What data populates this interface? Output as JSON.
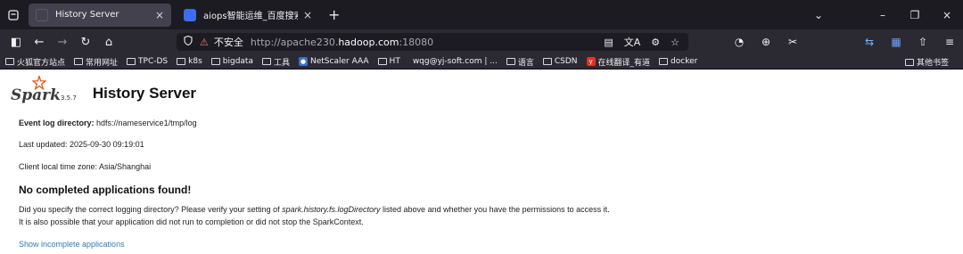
{
  "browser": {
    "tabs": [
      {
        "title": "History Server",
        "close": "×",
        "active": true
      },
      {
        "title": "aiops智能运维_百度搜索",
        "close": "×",
        "active": false
      }
    ],
    "new_tab": "+",
    "window_controls": {
      "list": "⌄",
      "minimize": "–",
      "restore": "❐",
      "close": "×"
    },
    "nav": {
      "sidebar": "◧",
      "back": "←",
      "forward": "→",
      "reload": "↻",
      "home": "⌂"
    },
    "url": {
      "insecure_icon": "⚠",
      "insecure_label": "不安全",
      "prefix": "http://apache230.",
      "host": "hadoop.com",
      "suffix": ":18080"
    },
    "url_actions": {
      "reader": "▤",
      "translate": "文A",
      "extensions": "⚙",
      "bookmark": "☆"
    },
    "toolbar_right": [
      "◔",
      "⊕",
      "✂",
      "⇆",
      "▦",
      "⇧",
      "≡"
    ],
    "bookmarks": [
      {
        "label": "火狐官方站点",
        "type": "folder"
      },
      {
        "label": "常用网址",
        "type": "folder"
      },
      {
        "label": "TPC-DS",
        "type": "folder"
      },
      {
        "label": "k8s",
        "type": "folder"
      },
      {
        "label": "bigdata",
        "type": "folder"
      },
      {
        "label": "工具",
        "type": "folder"
      },
      {
        "label": "NetScaler AAA",
        "type": "site"
      },
      {
        "label": "HT",
        "type": "folder"
      },
      {
        "label": "wqg@yj-soft.com | ...",
        "type": "plain"
      },
      {
        "label": "语言",
        "type": "folder"
      },
      {
        "label": "CSDN",
        "type": "folder"
      },
      {
        "label": "在线翻译_有道",
        "type": "youdao"
      },
      {
        "label": "docker",
        "type": "folder"
      }
    ],
    "other_bookmarks": "其他书签",
    "colors": {
      "chrome_dark": "#1c1b22",
      "chrome_mid": "#2b2a33",
      "active_tab": "#42414d"
    }
  },
  "page": {
    "logo_text": "Spark",
    "version": "3.5.7",
    "title": "History Server",
    "event_log_label": "Event log directory:",
    "event_log_value": "hdfs://nameservice1/tmp/log",
    "last_updated": "Last updated: 2025-09-30 09:19:01",
    "timezone": "Client local time zone: Asia/Shanghai",
    "no_apps_heading": "No completed applications found!",
    "help_1_pre": "Did you specify the correct logging directory? Please verify your setting of ",
    "help_1_em": "spark.history.fs.logDirectory",
    "help_1_post": " listed above and whether you have the permissions to access it.",
    "help_2": "It is also possible that your application did not run to completion or did not stop the SparkContext.",
    "incomplete_link": "Show incomplete applications",
    "colors": {
      "link": "#337ab7",
      "spark_orange": "#e25a1c"
    }
  }
}
